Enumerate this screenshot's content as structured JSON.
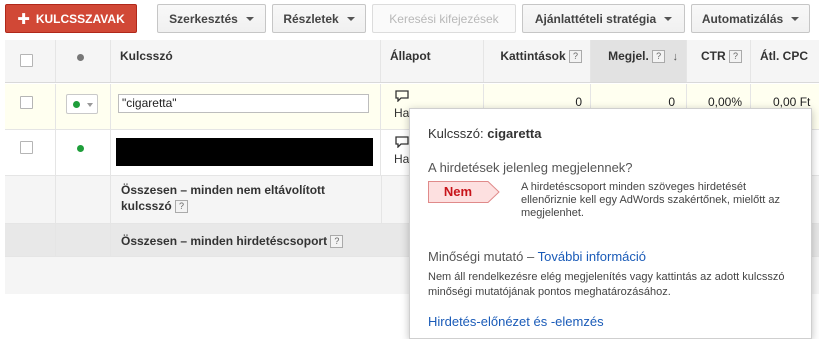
{
  "toolbar": {
    "add_keywords": "KULCSSZAVAK",
    "edit": "Szerkesztés",
    "details": "Részletek",
    "search_terms": "Keresési kifejezések",
    "bid_strategy": "Ajánlattételi stratégia",
    "automate": "Automatizálás"
  },
  "table": {
    "headers": {
      "keyword": "Kulcsszó",
      "status": "Állapot",
      "clicks": "Kattintások",
      "impressions": "Megjel.",
      "ctr": "CTR",
      "avg_cpc": "Átl. CPC",
      "help": "?",
      "sort_arrow": "↓"
    },
    "rows": [
      {
        "keyword": "\"cigaretta\"",
        "status": "Ha",
        "clicks": "0",
        "impressions": "0",
        "ctr": "0,00%",
        "avg_cpc": "0,00 Ft"
      },
      {
        "keyword": "",
        "status": "Ha"
      }
    ],
    "total_non_removed": "Összesen – minden nem eltávolított kulcsszó",
    "total_adgroup": "Összesen – minden hirdetéscsoport",
    "status_color": "#1e9e3a"
  },
  "popup": {
    "keyword_label": "Kulcsszó:",
    "keyword_value": "cigaretta",
    "question": "A hirdetések jelenleg megjelennek?",
    "answer": "Nem",
    "answer_note": "A hirdetéscsoport minden szöveges hirdetését ellenőriznie kell egy AdWords szakértőnek, mielőtt az megjelenhet.",
    "quality_label": "Minőségi mutató –",
    "quality_link": "További információ",
    "quality_note": "Nem áll rendelkezésre elég megjelenítés vagy kattintás az adott kulcsszó minőségi mutatójának pontos meghatározásához.",
    "preview_link": "Hirdetés-előnézet és -elemzés"
  }
}
